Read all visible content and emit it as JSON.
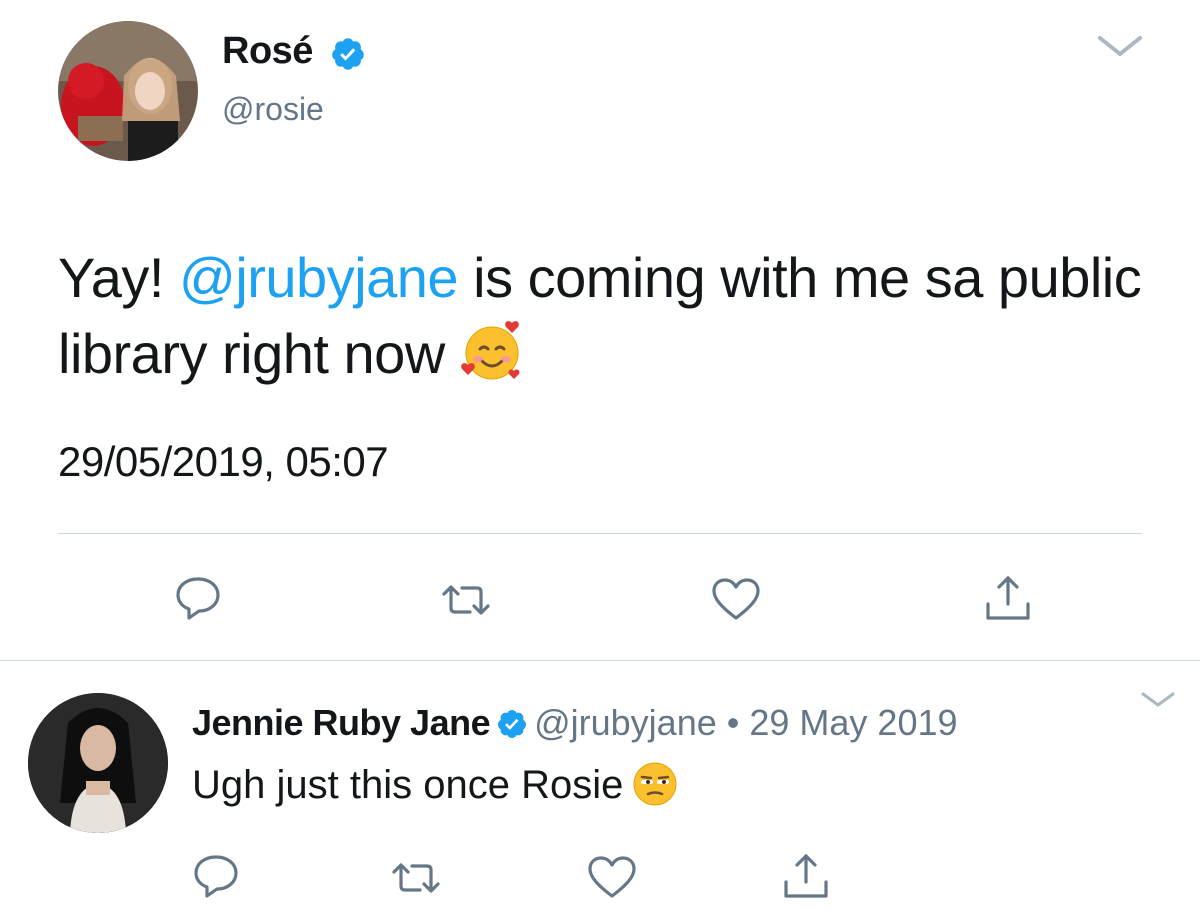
{
  "main_tweet": {
    "display_name": "Rosé",
    "handle": "@rosie",
    "text_prefix": "Yay! ",
    "mention": "@jrubyjane",
    "text_suffix": " is coming with me sa public library right now",
    "emoji": "smiling-face-with-hearts",
    "timestamp": "29/05/2019, 05:07",
    "actions": [
      "reply",
      "retweet",
      "like",
      "share"
    ]
  },
  "reply_tweet": {
    "display_name": "Jennie Ruby Jane",
    "handle": "@jrubyjane",
    "separator": " • ",
    "date": "29 May 2019",
    "text": "Ugh just this once Rosie",
    "emoji": "unamused-face",
    "actions": [
      "reply",
      "retweet",
      "like",
      "share"
    ]
  },
  "colors": {
    "link_blue": "#1da1f2",
    "verified_blue": "#1da1f2",
    "secondary_text": "#657786",
    "icon_gray": "#657786",
    "divider": "#ccd6dd"
  }
}
